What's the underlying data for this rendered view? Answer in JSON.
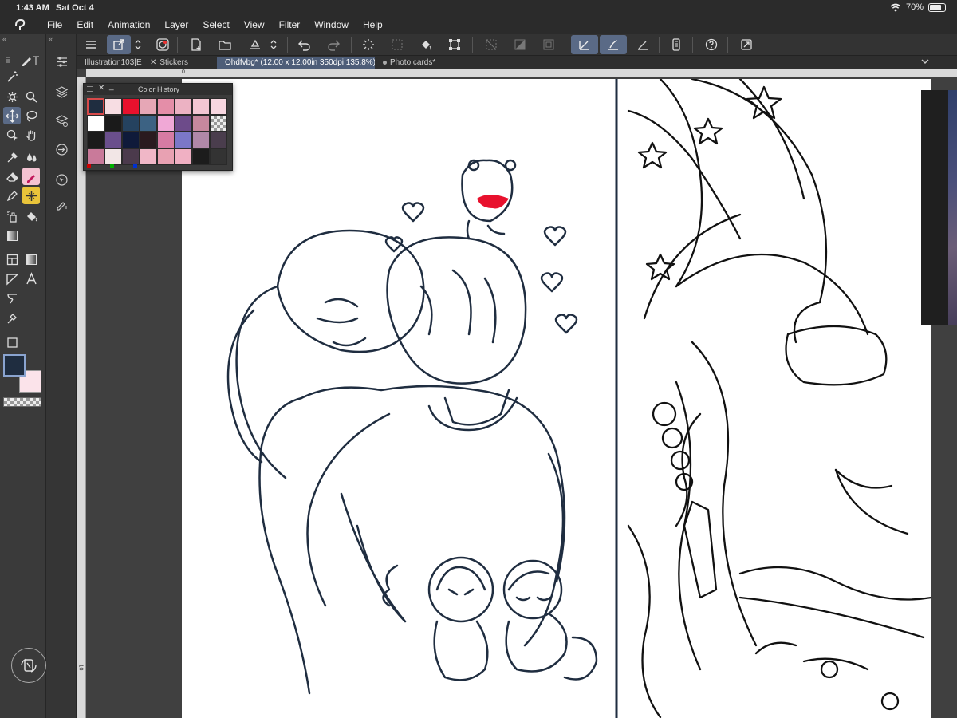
{
  "status": {
    "time": "1:43 AM",
    "date": "Sat Oct 4",
    "battery": "70%"
  },
  "menu": [
    "File",
    "Edit",
    "Animation",
    "Layer",
    "Select",
    "View",
    "Filter",
    "Window",
    "Help"
  ],
  "tabs": [
    {
      "label": "Illustration103[E"
    },
    {
      "label": "Stickers"
    },
    {
      "label": "Ohdfvbg* (12.00 x 12.00in 350dpi 135.8%)"
    },
    {
      "label": "Photo cards*"
    }
  ],
  "color_history": {
    "title": "Color History",
    "swatches": [
      "#1f2d40",
      "#f7dde3",
      "#e8112d",
      "#e6a7b6",
      "#e48ea8",
      "#ecb2c3",
      "#f3c7d3",
      "#f7d6e0",
      "#ffffff",
      "#1a1a1a",
      "#25425f",
      "#3c6283",
      "#f0a8d6",
      "#6d4b8a",
      "#c7889e",
      "checker",
      "#1b1b1b",
      "#6a4f8c",
      "#0f1a3a",
      "#2a1a1f",
      "#d67ba3",
      "#7b77c7",
      "#b088a8",
      "#4a3d4d",
      "#c97a9a",
      "#f2e6e6",
      "#4b3a4c",
      "#f0b7c7",
      "#e8a1b2",
      "#f0b0c3",
      "#1c1c1c",
      "#333333"
    ]
  },
  "colors": {
    "main": "#1f2d40",
    "sub": "#fbe3ea",
    "accent": "#5a6a86"
  },
  "ruler": {
    "top_origin": "0",
    "left_origin": "10"
  }
}
